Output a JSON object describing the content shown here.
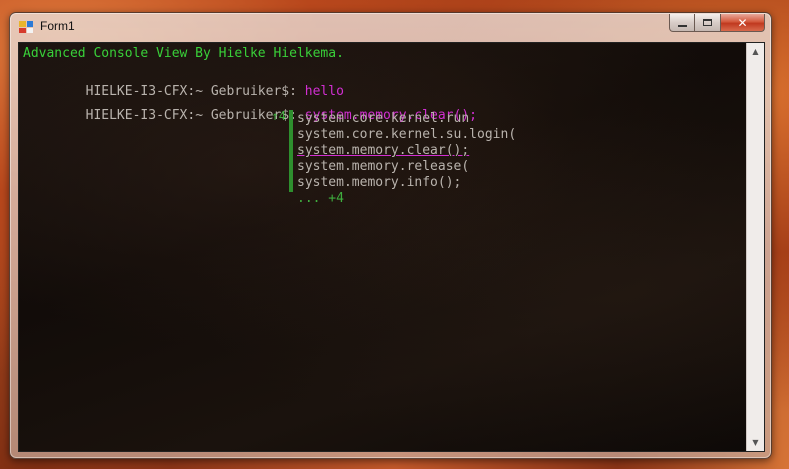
{
  "window": {
    "title": "Form1",
    "icon": "app-icon",
    "controls": {
      "minimize": "minimize-icon",
      "maximize": "maximize-icon",
      "close": "✕"
    }
  },
  "console": {
    "header": "Advanced Console View By Hielke Hielkema.",
    "lines": [
      {
        "prompt": "HIELKE-I3-CFX:~ Gebruiker$:",
        "input": "hello"
      },
      {
        "prompt": "HIELKE-I3-CFX:~ Gebruiker$:",
        "input": "system.memory.clear();"
      }
    ],
    "colors": {
      "header": "#39d039",
      "prompt": "#b9b3ad",
      "input": "#d22fd2",
      "autocomplete_accent": "#2e8f2e"
    }
  },
  "autocomplete": {
    "above_count": "↑4",
    "items": [
      "system.core.kernel.run",
      "system.core.kernel.su.login(",
      "system.memory.clear();",
      "system.memory.release(",
      "system.memory.info();"
    ],
    "selected_index": 2,
    "more": "... +4"
  },
  "scrollbar": {
    "up": "▲",
    "down": "▼"
  }
}
